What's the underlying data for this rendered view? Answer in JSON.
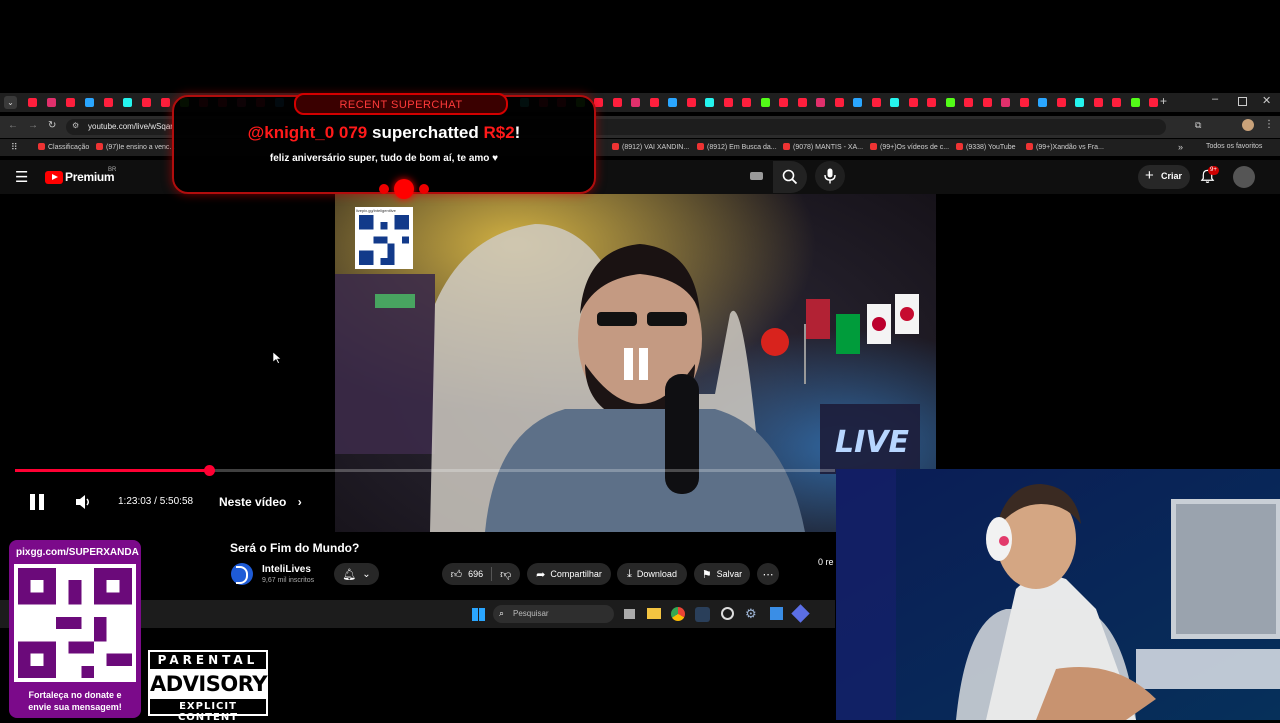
{
  "browser": {
    "url": "youtube.com/live/wSqar",
    "bookmarks": [
      "Classificação",
      "(97)Ie ensino a venc...",
      "(8912) VAI XANDIN...",
      "(8912) Em Busca da...",
      "(9078) MANTIS - XA...",
      "(99+)Os vídeos de c...",
      "(9338) YouTube",
      "(99+)Xandão vs Fra..."
    ],
    "all_bookmarks_label": "Todos os favoritos"
  },
  "youtube": {
    "logo_label": "Premium",
    "region": "BR",
    "create_label": "Criar",
    "notifications_badge": "9+"
  },
  "player": {
    "time": "1:23:03 / 5:50:58",
    "chapters_label": "Neste vídeo",
    "progress": 0.2365
  },
  "video": {
    "title": "Será o Fim do Mundo?",
    "channel": "InteliLives",
    "subscribers": "9,67 mil inscritos",
    "likes": "696",
    "share_label": "Compartilhar",
    "download_label": "Download",
    "save_label": "Salvar",
    "side_text": "0 re"
  },
  "taskbar": {
    "search_placeholder": "Pesquisar"
  },
  "superchat": {
    "banner": "RECENT SUPERCHAT",
    "user": "@knight_0 079",
    "action": "superchatted",
    "amount": "R$2",
    "exclaim": "!",
    "message": "feliz aniversário super, tudo de bom aí, te amo ♥"
  },
  "donation": {
    "url": "pixgg.com/SUPERXANDA",
    "caption_line1": "Fortaleça no donate e",
    "caption_line2": "envie sua mensagem!"
  },
  "qr_small": {
    "url": "livepix.gg/inteligentlive"
  },
  "parental": {
    "line1": "PARENTAL",
    "line2": "ADVISORY",
    "line3": "EXPLICIT CONTENT"
  },
  "colors": {
    "accent_red": "#ff0033",
    "superchat_red": "#d40000",
    "youtube_red": "#ff0000"
  }
}
